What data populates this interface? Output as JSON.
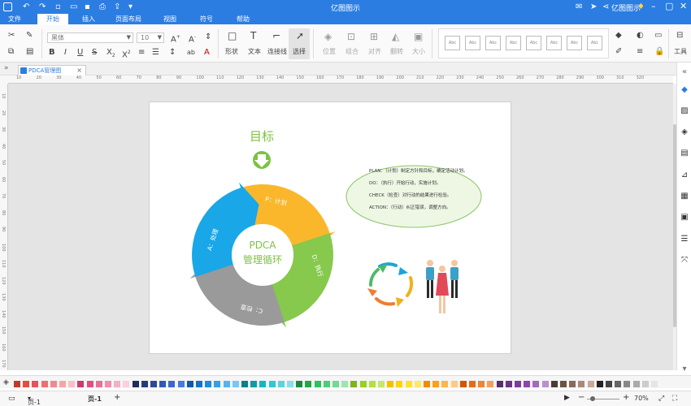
{
  "window": {
    "title": "亿图图示",
    "account_label": "亿图图示"
  },
  "menu": {
    "tabs": [
      {
        "label": "文件",
        "active": false
      },
      {
        "label": "开始",
        "active": true
      },
      {
        "label": "插入",
        "active": false
      },
      {
        "label": "页面布局",
        "active": false
      },
      {
        "label": "视图",
        "active": false
      },
      {
        "label": "符号",
        "active": false
      },
      {
        "label": "帮助",
        "active": false
      }
    ]
  },
  "ribbon": {
    "font_name": "黑体",
    "font_size": "10",
    "tools": [
      {
        "label": "形状",
        "enabled": true
      },
      {
        "label": "文本",
        "enabled": true
      },
      {
        "label": "连接线",
        "enabled": true
      },
      {
        "label": "选择",
        "enabled": true
      },
      {
        "label": "位置",
        "enabled": false
      },
      {
        "label": "组合",
        "enabled": false
      },
      {
        "label": "对齐",
        "enabled": false
      },
      {
        "label": "翻转",
        "enabled": false
      },
      {
        "label": "大小",
        "enabled": false
      }
    ],
    "style_samples": [
      "Abc",
      "Abc",
      "Abc",
      "Abc",
      "Abc",
      "Abc",
      "Abc",
      "Abc"
    ],
    "tools_label": "工具"
  },
  "document": {
    "tab_title": "PDCA管理图"
  },
  "ruler": {
    "h_ticks": [
      "10",
      "20",
      "30",
      "40",
      "50",
      "60",
      "70",
      "80",
      "90",
      "100",
      "110",
      "120",
      "130",
      "140",
      "150",
      "160",
      "170",
      "180",
      "190",
      "200",
      "210",
      "220",
      "230",
      "240",
      "250",
      "260",
      "270",
      "280",
      "290",
      "300",
      "310",
      "320"
    ],
    "v_ticks": [
      "10",
      "20",
      "30",
      "40",
      "50",
      "60",
      "70",
      "80",
      "90",
      "100",
      "110",
      "120",
      "130",
      "140",
      "150",
      "160",
      "170"
    ]
  },
  "diagram": {
    "goal_label": "目标",
    "center_line1": "PDCA",
    "center_line2": "管理循环",
    "segments": [
      {
        "label": "P：计划",
        "color": "#fbb72b"
      },
      {
        "label": "D：执行",
        "color": "#86c94d"
      },
      {
        "label": "C：检查",
        "color": "#9a9a9a"
      },
      {
        "label": "A：处理",
        "color": "#19a7e8"
      }
    ],
    "explanation": [
      "PLAN：（计划）制定方针和目标，确定活动计划。",
      "DO：（执行）开始行动，实施计划。",
      "CHECK（检查）对行动的结果进行检验。",
      "ACTION：（行动）纠正错误，调整方向。"
    ],
    "accent_green": "#7dc242"
  },
  "palette": {
    "colors": [
      "#c0392b",
      "#e74c3c",
      "#e8505b",
      "#ec6f76",
      "#f08a8f",
      "#f5a5a9",
      "#f9c0c2",
      "#c93c6b",
      "#e04f82",
      "#e86f98",
      "#ef8fae",
      "#f5afc4",
      "#fbcfdb",
      "#1f2d5c",
      "#253b7a",
      "#2c4a98",
      "#3359b5",
      "#3a68d3",
      "#4a78e0",
      "#0e5aa7",
      "#1473c9",
      "#1b8ce0",
      "#35a0ea",
      "#54b3f0",
      "#7bc6f5",
      "#0b7f8a",
      "#0e9ba8",
      "#12b6c5",
      "#34c6d2",
      "#5dd3dc",
      "#89e0e6",
      "#1a8a3f",
      "#21a64d",
      "#2ac25b",
      "#4ccd76",
      "#73d993",
      "#9de5b2",
      "#7cb518",
      "#97d11f",
      "#b2e03f",
      "#c5e86b",
      "#f5c000",
      "#ffd400",
      "#ffe033",
      "#ffe866",
      "#f08c00",
      "#ff9f1a",
      "#ffb44d",
      "#ffc980",
      "#d35400",
      "#e86a17",
      "#f08433",
      "#f59f5c",
      "#5b2c6f",
      "#6c3483",
      "#7d3c98",
      "#8e44ad",
      "#a569bd",
      "#bb8fce",
      "#4d3b32",
      "#6b5344",
      "#8a6b57",
      "#a98a75",
      "#c7ab97",
      "#222222",
      "#444444",
      "#666666",
      "#888888",
      "#aaaaaa",
      "#cccccc",
      "#e5e5e5"
    ]
  },
  "status": {
    "page_selector": "页-1",
    "page_tab": "页-1",
    "zoom": "70%"
  }
}
